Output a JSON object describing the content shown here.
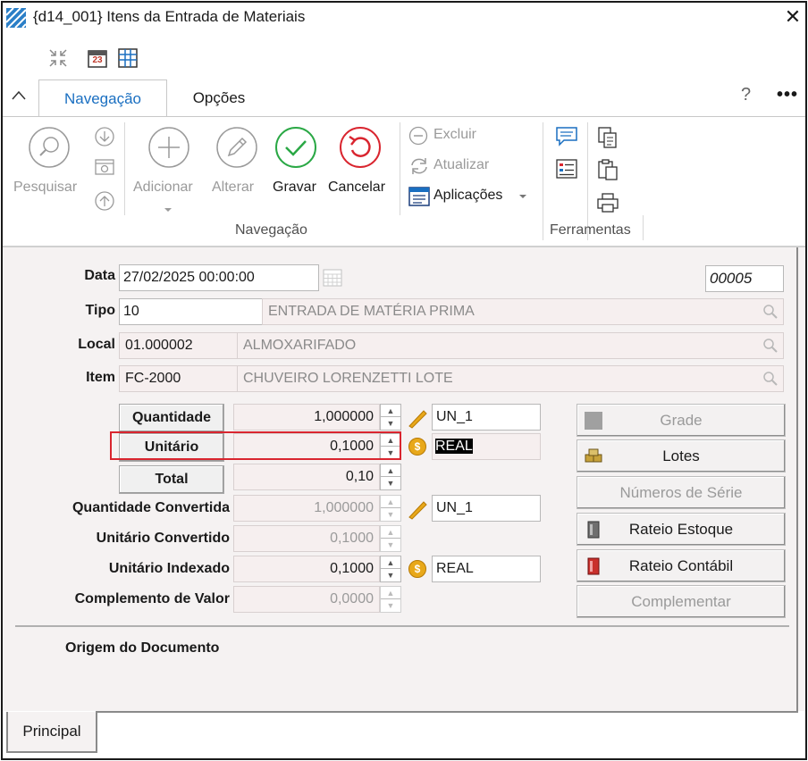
{
  "window": {
    "title": "{d14_001} Itens da Entrada de Materiais",
    "app_icon": "app-grid-icon",
    "close_label": "✕",
    "quick_access": [
      "collapse-arrows-icon",
      "calendar-23-icon",
      "grid-table-icon"
    ],
    "calendar_day": "23"
  },
  "tabs": {
    "navegacao": "Navegação",
    "opcoes": "Opções",
    "help": "?",
    "more": "•••"
  },
  "ribbon": {
    "pesquisar": "Pesquisar",
    "adicionar": "Adicionar",
    "alterar": "Alterar",
    "gravar": "Gravar",
    "cancelar": "Cancelar",
    "excluir": "Excluir",
    "atualizar": "Atualizar",
    "aplicacoes": "Aplicações",
    "group_navegacao": "Navegação",
    "group_ferramentas": "Ferramentas"
  },
  "form": {
    "data_label": "Data",
    "data_value": "27/02/2025 00:00:00",
    "code_value": "00005",
    "tipo_label": "Tipo",
    "tipo_code": "10",
    "tipo_desc": "ENTRADA DE MATÉRIA PRIMA",
    "local_label": "Local",
    "local_code": "01.000002",
    "local_desc": "ALMOXARIFADO",
    "item_label": "Item",
    "item_code": "FC-2000",
    "item_desc": "CHUVEIRO LORENZETTI LOTE",
    "quantidade_label": "Quantidade",
    "quantidade_value": "1,000000",
    "quantidade_unit": "UN_1",
    "unitario_label": "Unitário",
    "unitario_value": "0,1000",
    "unitario_currency": "REAL",
    "total_label": "Total",
    "total_value": "0,10",
    "qtd_conv_label": "Quantidade Convertida",
    "qtd_conv_value": "1,000000",
    "qtd_conv_unit": "UN_1",
    "unit_conv_label": "Unitário Convertido",
    "unit_conv_value": "0,1000",
    "unit_idx_label": "Unitário Indexado",
    "unit_idx_value": "0,1000",
    "unit_idx_currency": "REAL",
    "compl_label": "Complemento de Valor",
    "compl_value": "0,0000",
    "coin_symbol": "$",
    "origem_label": "Origem do Documento"
  },
  "side_buttons": {
    "grade": "Grade",
    "lotes": "Lotes",
    "numeros_serie": "Números de Série",
    "rateio_estoque": "Rateio Estoque",
    "rateio_contabil": "Rateio Contábil",
    "complementar": "Complementar"
  },
  "bottom_tab": "Principal",
  "colors": {
    "accent": "#1a6fc1",
    "gravar_green": "#2aa845",
    "cancelar_red": "#d9252f",
    "highlight_box": "#d9252f"
  }
}
